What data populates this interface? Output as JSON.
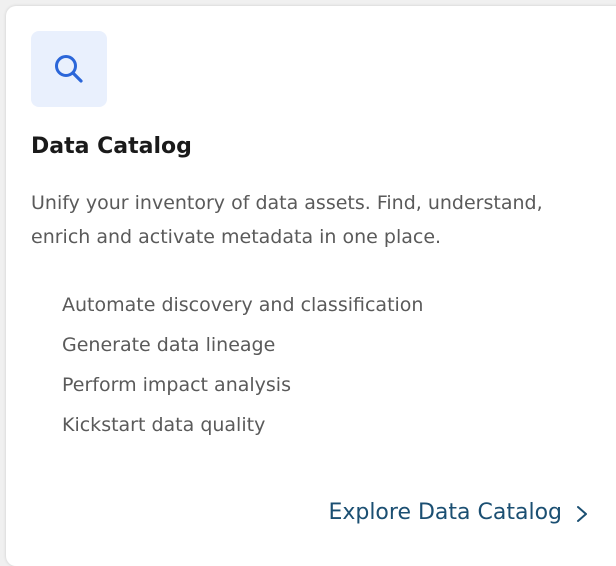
{
  "card": {
    "icon": "search-icon",
    "title": "Data Catalog",
    "description": "Unify your inventory of data assets. Find, understand, enrich and activate metadata in one place.",
    "features": [
      "Automate discovery and classification",
      "Generate data lineage",
      "Perform impact analysis",
      "Kickstart data quality"
    ],
    "link_label": "Explore Data Catalog",
    "link_icon": "chevron-right-icon"
  },
  "colors": {
    "icon_bg": "#e9f0fd",
    "icon_stroke": "#2b66d9",
    "link": "#1b4f72",
    "text_muted": "#5a5a5a",
    "title": "#1a1a1a"
  }
}
